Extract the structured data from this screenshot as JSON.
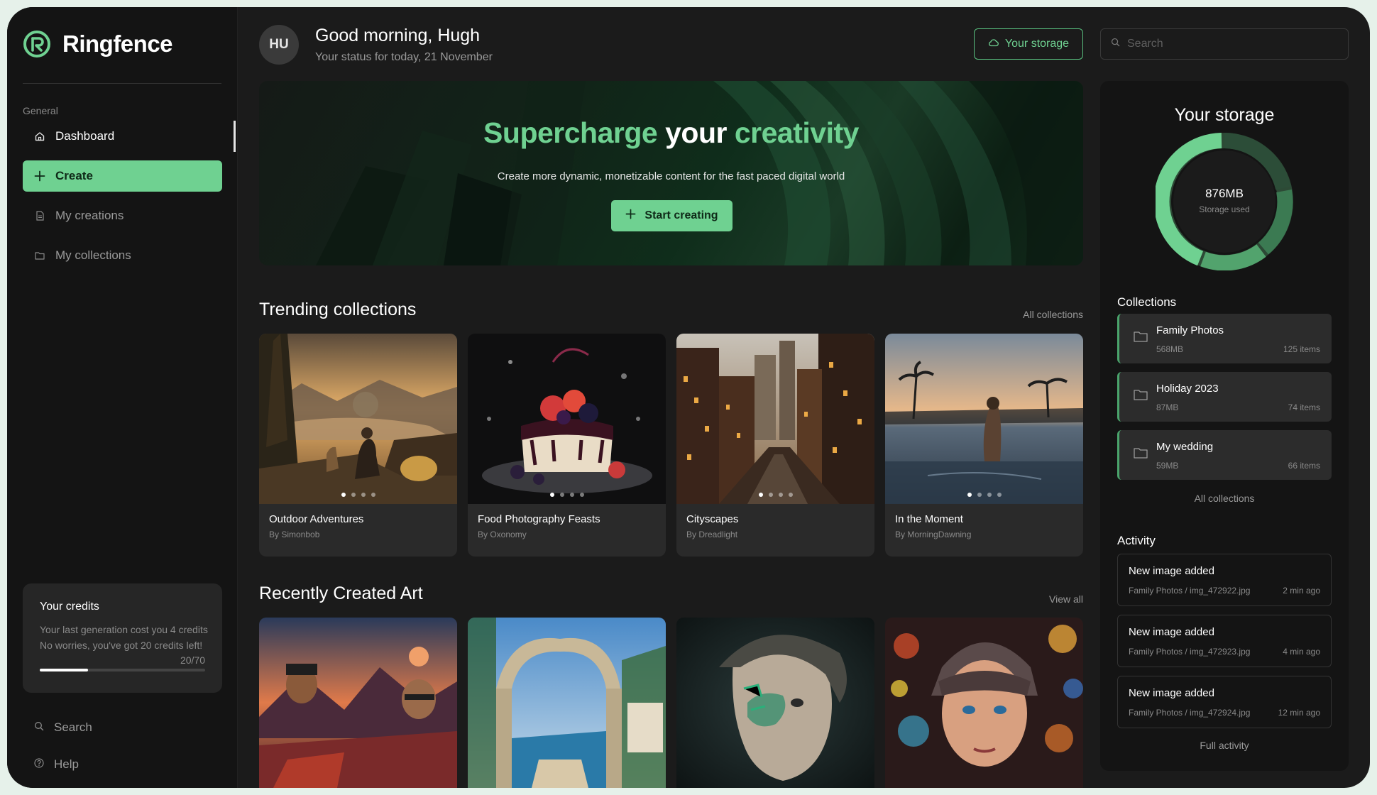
{
  "app": {
    "name": "Ringfence",
    "accent": "#6fd191"
  },
  "sidebar": {
    "section": "General",
    "items": [
      {
        "label": "Dashboard",
        "icon": "home-icon"
      },
      {
        "label": "Create",
        "icon": "plus-icon"
      },
      {
        "label": "My creations",
        "icon": "document-icon"
      },
      {
        "label": "My collections",
        "icon": "folder-icon"
      }
    ],
    "credits": {
      "title": "Your credits",
      "line1": "Your last generation cost you 4 credits",
      "line2": "No worries, you've got 20 credits left!",
      "count": "20/70",
      "progress": 0.29
    },
    "bottom": [
      {
        "label": "Search",
        "icon": "search-icon"
      },
      {
        "label": "Help",
        "icon": "help-icon"
      }
    ]
  },
  "header": {
    "avatar": "HU",
    "greeting": "Good morning, Hugh",
    "status": "Your status for today, 21 November",
    "storage_button": "Your storage",
    "search_placeholder": "Search"
  },
  "hero": {
    "title_1": "Supercharge",
    "title_2": "your",
    "title_3": "creativity",
    "subtitle": "Create more dynamic, monetizable content for the fast paced digital world",
    "button": "Start creating"
  },
  "trending": {
    "title": "Trending collections",
    "link": "All collections",
    "cards": [
      {
        "title": "Outdoor Adventures",
        "by": "By Simonbob"
      },
      {
        "title": "Food Photography Feasts",
        "by": "By Oxonomy"
      },
      {
        "title": "Cityscapes",
        "by": "By Dreadlight"
      },
      {
        "title": "In the Moment",
        "by": "By MorningDawning"
      }
    ]
  },
  "recent": {
    "title": "Recently Created Art",
    "link": "View all"
  },
  "storage": {
    "title": "Your storage",
    "value": "876MB",
    "label": "Storage used",
    "collections_title": "Collections",
    "collections": [
      {
        "name": "Family Photos",
        "size": "568MB",
        "items": "125 items"
      },
      {
        "name": "Holiday 2023",
        "size": "87MB",
        "items": "74 items"
      },
      {
        "name": "My wedding",
        "size": "59MB",
        "items": "66 items"
      }
    ],
    "collections_link": "All collections",
    "activity_title": "Activity",
    "activity": [
      {
        "title": "New image added",
        "path": "Family Photos / img_472922.jpg",
        "time": "2 min ago"
      },
      {
        "title": "New image added",
        "path": "Family Photos / img_472923.jpg",
        "time": "4 min ago"
      },
      {
        "title": "New image added",
        "path": "Family Photos / img_472924.jpg",
        "time": "12 min ago"
      }
    ],
    "activity_link": "Full activity"
  }
}
